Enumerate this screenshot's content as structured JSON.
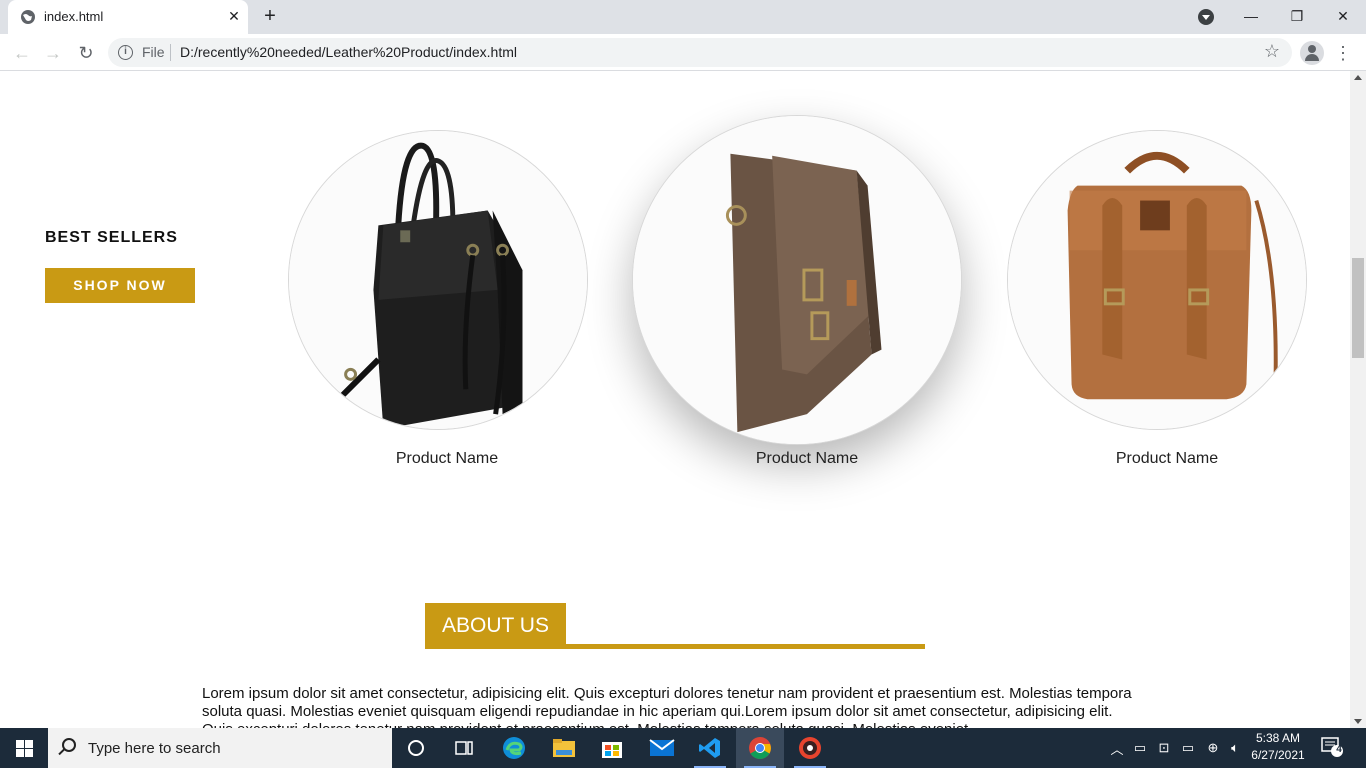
{
  "browser": {
    "tab_title": "index.html",
    "new_tab_label": "+",
    "address_scheme_label": "File",
    "address_url": "D:/recently%20needed/Leather%20Product/index.html"
  },
  "page": {
    "best_sellers_heading": "BEST SELLERS",
    "shop_now_label": "SHOP NOW",
    "products": [
      {
        "name": "Product Name"
      },
      {
        "name": "Product Name"
      },
      {
        "name": "Product Name"
      }
    ],
    "about_heading": "ABOUT US",
    "about_text": "Lorem ipsum dolor sit amet consectetur, adipisicing elit. Quis excepturi dolores tenetur nam provident et praesentium est. Molestias tempora soluta quasi. Molestias eveniet quisquam eligendi repudiandae in hic aperiam qui.Lorem ipsum dolor sit amet consectetur, adipisicing elit. Quis excepturi dolores tenetur nam provident et praesentium est. Molestias tempora soluta quasi. Molestias eveniet",
    "accent_color": "#c99a14"
  },
  "taskbar": {
    "search_placeholder": "Type here to search",
    "time": "5:38 AM",
    "date": "6/27/2021",
    "notification_count": "4"
  }
}
